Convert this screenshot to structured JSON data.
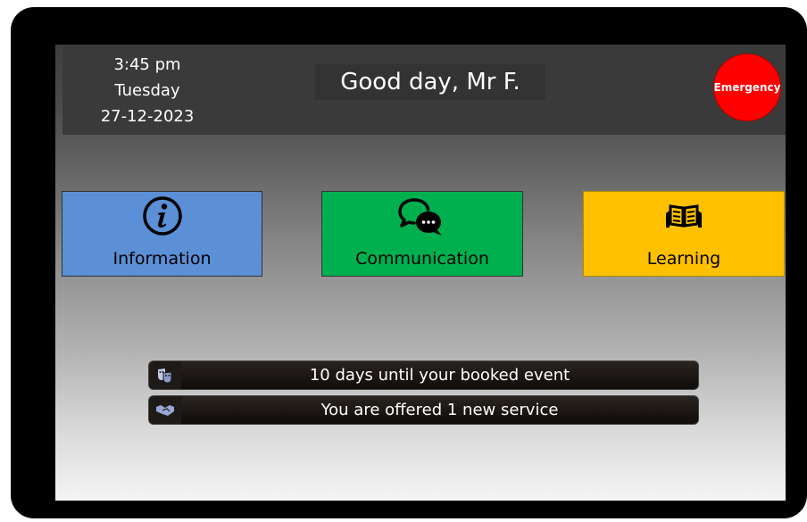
{
  "header": {
    "time": "3:45 pm",
    "day": "Tuesday",
    "date": "27-12-2023",
    "greeting": "Good day, Mr F.",
    "emergency_label": "Emergency"
  },
  "tiles": [
    {
      "label": "Information",
      "icon": "info-icon",
      "color": "#5b8fd6"
    },
    {
      "label": "Communication",
      "icon": "chat-bubbles-icon",
      "color": "#00b04f"
    },
    {
      "label": "Learning",
      "icon": "open-book-icon",
      "color": "#ffc000"
    }
  ],
  "notifications": [
    {
      "text": "10 days until your booked event",
      "icon": "theater-masks-icon"
    },
    {
      "text": "You are offered 1 new service",
      "icon": "handshake-icon"
    }
  ],
  "colors": {
    "emergency": "#ff0000",
    "header_bg": "#3a3a3a"
  }
}
